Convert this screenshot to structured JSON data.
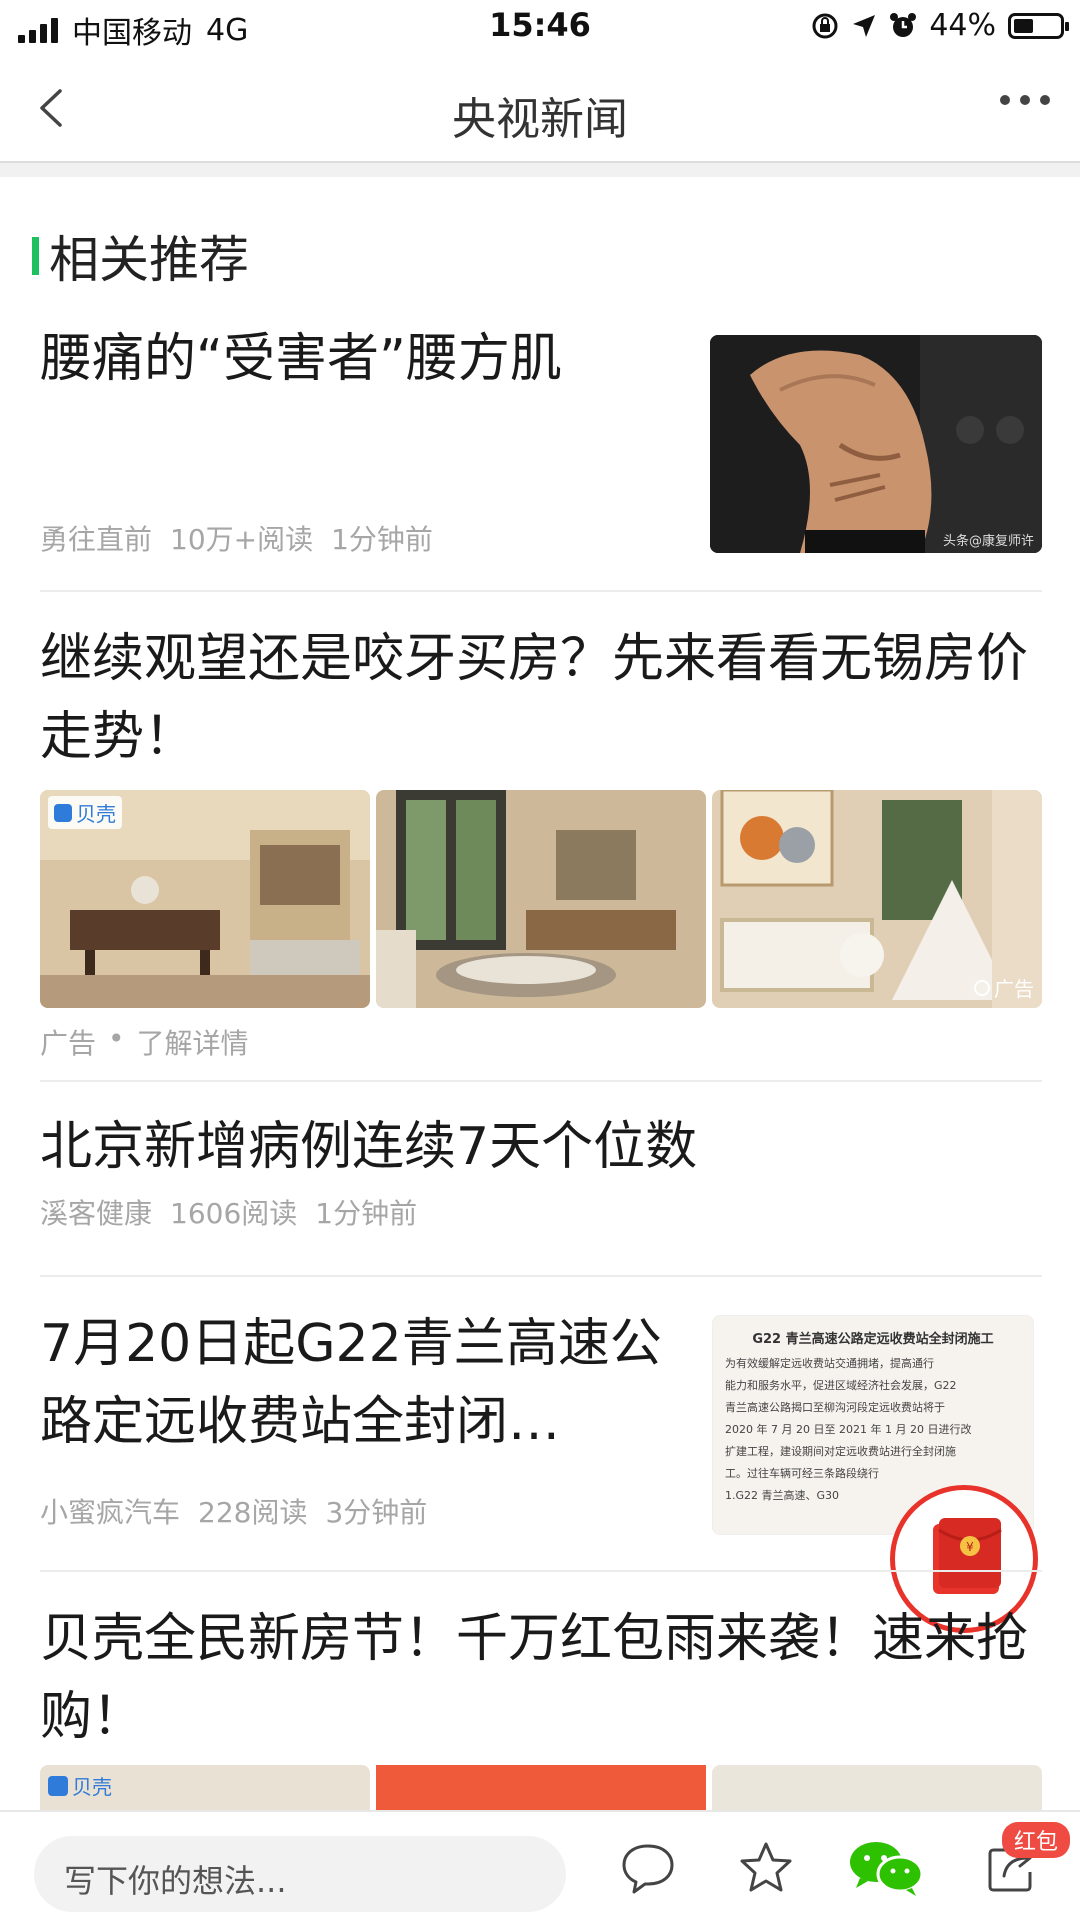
{
  "status_bar": {
    "carrier": "中国移动",
    "network": "4G",
    "time": "15:46",
    "battery_percent": "44%",
    "battery_level": 0.44
  },
  "nav": {
    "title": "央视新闻"
  },
  "section": {
    "title": "相关推荐"
  },
  "articles": [
    {
      "headline": "腰痛的“受害者”腰方肌",
      "source": "勇往直前",
      "reads": "10万+阅读",
      "time": "1分钟前",
      "thumb_caption": "头条@康复师许"
    },
    {
      "headline": "继续观望还是咬牙买房？先来看看无锡房价走势！",
      "ad_label": "广告",
      "ad_dot": "•",
      "ad_link": "了解详情",
      "brand": "贝壳",
      "ad_tag": "广告"
    },
    {
      "headline": "北京新增病例连续7天个位数",
      "source": "溪客健康",
      "reads": "1606阅读",
      "time": "1分钟前"
    },
    {
      "headline": "7月20日起G22青兰高速公路定远收费站全封闭…",
      "source": "小蜜疯汽车",
      "reads": "228阅读",
      "time": "3分钟前",
      "thumb_title": "G22 青兰高速公路定远收费站全封闭施工",
      "thumb_lines": [
        "为有效缓解定远收费站交通拥堵，提高通行",
        "能力和服务水平，促进区域经济社会发展，G22",
        "青兰高速公路揭口至柳沟河段定远收费站将于",
        "2020 年 7 月 20 日至 2021 年 1 月 20 日进行改",
        "扩建工程，建设期间对定远收费站进行全封闭施",
        "工。过往车辆可经三条路段绕行",
        "1.G22 青兰高速、G30"
      ]
    },
    {
      "headline": "贝壳全民新房节！千万红包雨来袭！速来抢购！",
      "brand": "贝壳"
    }
  ],
  "bottom_bar": {
    "comment_placeholder": "写下你的想法...",
    "red_packet_badge": "红包"
  },
  "colors": {
    "accent_green": "#1ec160",
    "red_packet": "#e8332b",
    "wechat_green": "#2dc100"
  },
  "icons": [
    "back-icon",
    "more-icon",
    "comment-icon",
    "star-icon",
    "wechat-icon",
    "share-icon",
    "red-packet-icon"
  ]
}
